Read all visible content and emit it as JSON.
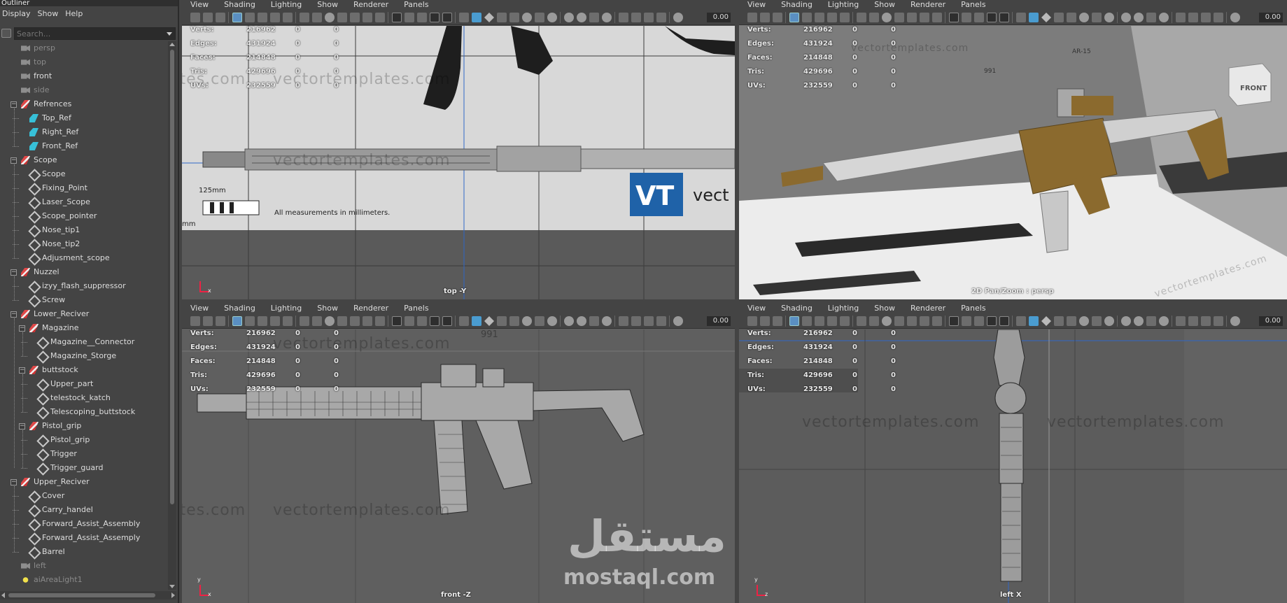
{
  "outliner": {
    "title": "Outliner",
    "menu": [
      "Display",
      "Show",
      "Help"
    ],
    "search_placeholder": "Search...",
    "items": [
      {
        "label": "persp",
        "depth": 0,
        "icon": "camera",
        "dim": true,
        "expander": ""
      },
      {
        "label": "top",
        "depth": 0,
        "icon": "camera",
        "dim": true,
        "expander": ""
      },
      {
        "label": "front",
        "depth": 0,
        "icon": "camera",
        "dim": false,
        "expander": ""
      },
      {
        "label": "side",
        "depth": 0,
        "icon": "camera",
        "dim": true,
        "expander": ""
      },
      {
        "label": "Refrences",
        "depth": 0,
        "icon": "group",
        "dim": false,
        "expander": "−"
      },
      {
        "label": "Top_Ref",
        "depth": 1,
        "icon": "reference",
        "dim": false,
        "expander": ""
      },
      {
        "label": "Right_Ref",
        "depth": 1,
        "icon": "reference",
        "dim": false,
        "expander": ""
      },
      {
        "label": "Front_Ref",
        "depth": 1,
        "icon": "reference",
        "dim": false,
        "expander": ""
      },
      {
        "label": "Scope",
        "depth": 0,
        "icon": "group",
        "dim": false,
        "expander": "−"
      },
      {
        "label": "Scope",
        "depth": 1,
        "icon": "mesh",
        "dim": false,
        "expander": ""
      },
      {
        "label": "Fixing_Point",
        "depth": 1,
        "icon": "mesh",
        "dim": false,
        "expander": ""
      },
      {
        "label": "Laser_Scope",
        "depth": 1,
        "icon": "mesh",
        "dim": false,
        "expander": ""
      },
      {
        "label": "Scope_pointer",
        "depth": 1,
        "icon": "mesh",
        "dim": false,
        "expander": ""
      },
      {
        "label": "Nose_tip1",
        "depth": 1,
        "icon": "mesh",
        "dim": false,
        "expander": ""
      },
      {
        "label": "Nose_tip2",
        "depth": 1,
        "icon": "mesh",
        "dim": false,
        "expander": ""
      },
      {
        "label": "Adjusment_scope",
        "depth": 1,
        "icon": "mesh",
        "dim": false,
        "expander": ""
      },
      {
        "label": "Nuzzel",
        "depth": 0,
        "icon": "group",
        "dim": false,
        "expander": "−"
      },
      {
        "label": "izyy_flash_suppressor",
        "depth": 1,
        "icon": "mesh",
        "dim": false,
        "expander": ""
      },
      {
        "label": "Screw",
        "depth": 1,
        "icon": "mesh",
        "dim": false,
        "expander": ""
      },
      {
        "label": "Lower_Reciver",
        "depth": 0,
        "icon": "group",
        "dim": false,
        "expander": "−"
      },
      {
        "label": "Magazine",
        "depth": 1,
        "icon": "group",
        "dim": false,
        "expander": "−"
      },
      {
        "label": "Magazine__Connector",
        "depth": 2,
        "icon": "mesh",
        "dim": false,
        "expander": ""
      },
      {
        "label": "Magazine_Storge",
        "depth": 2,
        "icon": "mesh",
        "dim": false,
        "expander": ""
      },
      {
        "label": "buttstock",
        "depth": 1,
        "icon": "group",
        "dim": false,
        "expander": "−"
      },
      {
        "label": "Upper_part",
        "depth": 2,
        "icon": "mesh",
        "dim": false,
        "expander": ""
      },
      {
        "label": "telestock_katch",
        "depth": 2,
        "icon": "mesh",
        "dim": false,
        "expander": ""
      },
      {
        "label": "Telescoping_buttstock",
        "depth": 2,
        "icon": "mesh",
        "dim": false,
        "expander": ""
      },
      {
        "label": "Pistol_grip",
        "depth": 1,
        "icon": "group",
        "dim": false,
        "expander": "−"
      },
      {
        "label": "Pistol_grip",
        "depth": 2,
        "icon": "mesh",
        "dim": false,
        "expander": ""
      },
      {
        "label": "Trigger",
        "depth": 2,
        "icon": "mesh",
        "dim": false,
        "expander": ""
      },
      {
        "label": "Trigger_guard",
        "depth": 2,
        "icon": "mesh",
        "dim": false,
        "expander": ""
      },
      {
        "label": "Upper_Reciver",
        "depth": 0,
        "icon": "group",
        "dim": false,
        "expander": "−"
      },
      {
        "label": "Cover",
        "depth": 1,
        "icon": "mesh",
        "dim": false,
        "expander": ""
      },
      {
        "label": "Carry_handel",
        "depth": 1,
        "icon": "mesh",
        "dim": false,
        "expander": ""
      },
      {
        "label": "Forward_Assist_Assembly",
        "depth": 1,
        "icon": "mesh",
        "dim": false,
        "expander": ""
      },
      {
        "label": "Forward_Assist_Assemply",
        "depth": 1,
        "icon": "mesh",
        "dim": false,
        "expander": ""
      },
      {
        "label": "Barrel",
        "depth": 1,
        "icon": "mesh",
        "dim": false,
        "expander": ""
      },
      {
        "label": "left",
        "depth": 0,
        "icon": "camera",
        "dim": true,
        "expander": ""
      },
      {
        "label": "aiAreaLight1",
        "depth": 0,
        "icon": "light",
        "dim": true,
        "expander": ""
      }
    ]
  },
  "viewport_menu": [
    "View",
    "Shading",
    "Lighting",
    "Show",
    "Renderer",
    "Panels"
  ],
  "hud_labels": [
    "Verts:",
    "Edges:",
    "Faces:",
    "Tris:",
    "UVs:"
  ],
  "hud_values": [
    [
      "216962",
      "0",
      "0"
    ],
    [
      "431924",
      "0",
      "0"
    ],
    [
      "214848",
      "0",
      "0"
    ],
    [
      "429696",
      "0",
      "0"
    ],
    [
      "232559",
      "0",
      "0"
    ]
  ],
  "viewports": {
    "top": {
      "label": "top -Y",
      "zoom": "0.00",
      "axis_y": "",
      "axis_x": "x"
    },
    "persp": {
      "label": "2D Pan/Zoom : persp",
      "zoom": "0.00"
    },
    "front": {
      "label": "front -Z",
      "zoom": "0.00",
      "axis_y": "y",
      "axis_x": "x"
    },
    "left": {
      "label": "left X",
      "zoom": "0.00",
      "axis_y": "y",
      "axis_x": "z"
    }
  },
  "reference_sheet": {
    "watermark": "vectortemplates.com",
    "watermark_alt": "plates.com",
    "measure": "All measurements in millimeters.",
    "dimension": "125mm",
    "dimension_unit": "mm",
    "logo_text": "vect",
    "model_label": "991",
    "model_label_persp": "AR-15",
    "cube_label": "FRONT"
  },
  "watermark": {
    "arabic": "مستقل",
    "latin": "mostaql.com"
  },
  "colors": {
    "ui_bg": "#444444",
    "accent": "#4a9cd0",
    "fde": "#8b6a2e",
    "vt_blue": "#1f62a8"
  }
}
